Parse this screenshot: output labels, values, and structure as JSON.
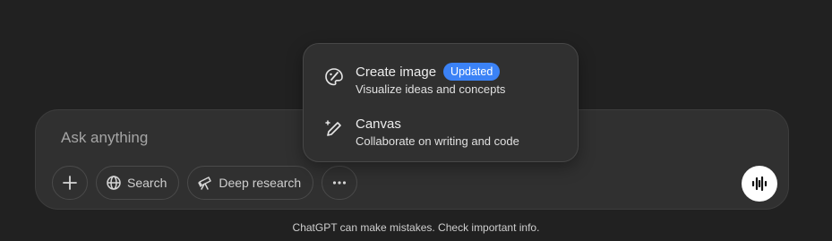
{
  "composer": {
    "placeholder": "Ask anything",
    "tools": {
      "add_icon": "plus-icon",
      "search_label": "Search",
      "deep_research_label": "Deep research",
      "more_icon": "ellipsis-icon"
    },
    "voice_icon": "voice-waveform-icon"
  },
  "menu": {
    "items": [
      {
        "icon": "paint-palette-icon",
        "title": "Create image",
        "badge": "Updated",
        "description": "Visualize ideas and concepts"
      },
      {
        "icon": "pen-sparkle-icon",
        "title": "Canvas",
        "description": "Collaborate on writing and code"
      }
    ]
  },
  "footer": {
    "disclaimer": "ChatGPT can make mistakes. Check important info."
  },
  "colors": {
    "background": "#212121",
    "composer_bg": "#303030",
    "badge_blue": "#3b82f6"
  }
}
